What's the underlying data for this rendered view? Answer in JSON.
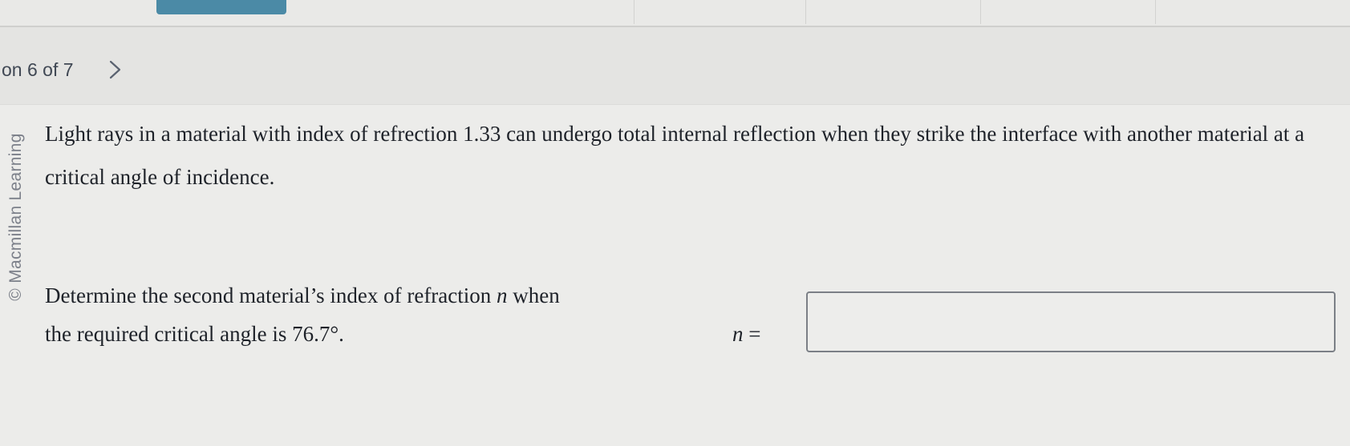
{
  "header": {
    "question_counter": "on 6 of 7",
    "next_icon": "chevron-right-icon"
  },
  "watermark": {
    "text": "© Macmillan Learning"
  },
  "problem": {
    "text": "Light rays in a material with index of refrection 1.33 can undergo total internal reflection when they strike the interface with another material at a critical angle of incidence."
  },
  "question": {
    "line1_before": "Determine the second material’s index of refraction ",
    "variable": "n",
    "line1_after": " when",
    "line2": "the required critical angle is 76.7°."
  },
  "answer": {
    "variable": "n",
    "equals": " =",
    "value": "",
    "placeholder": ""
  }
}
